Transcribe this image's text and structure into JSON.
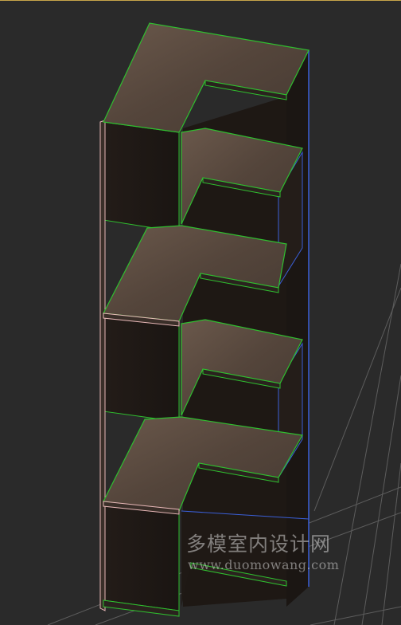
{
  "viewport": {
    "background": "#2a2a2a",
    "border_color": "#c8a64a",
    "grid_color": "#5d5d5d"
  },
  "model": {
    "wood_top": "#5a4a3f",
    "wood_dark": "#1e1815",
    "wood_side": "#2a221e",
    "edge_green": "#2fbf2f",
    "edge_pink": "#e8b8b8",
    "edge_blue": "#3a5fd8"
  },
  "watermark": {
    "site_name": "多模室内设计网",
    "url": "www.duomowang.com"
  }
}
